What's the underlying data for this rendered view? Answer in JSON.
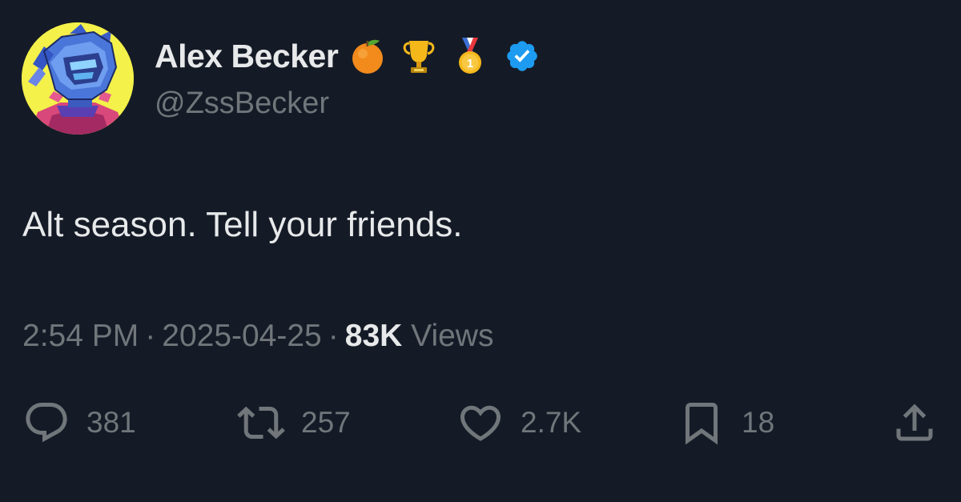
{
  "author": {
    "display_name": "Alex Becker",
    "handle": "@ZssBecker",
    "badges": [
      "orange-emoji",
      "trophy-emoji",
      "first-place-medal-emoji",
      "verified-badge-icon"
    ]
  },
  "tweet": {
    "text": "Alt season. Tell your friends."
  },
  "meta": {
    "time": "2:54 PM",
    "separator": "·",
    "date": "2025-04-25",
    "views_count": "83K",
    "views_label": "Views"
  },
  "actions": {
    "replies": "381",
    "retweets": "257",
    "likes": "2.7K",
    "bookmarks": "18"
  },
  "colors": {
    "background": "#151b26",
    "text_primary": "#e7e9ea",
    "text_secondary": "#71767b",
    "verified_blue": "#1d9bf0"
  }
}
